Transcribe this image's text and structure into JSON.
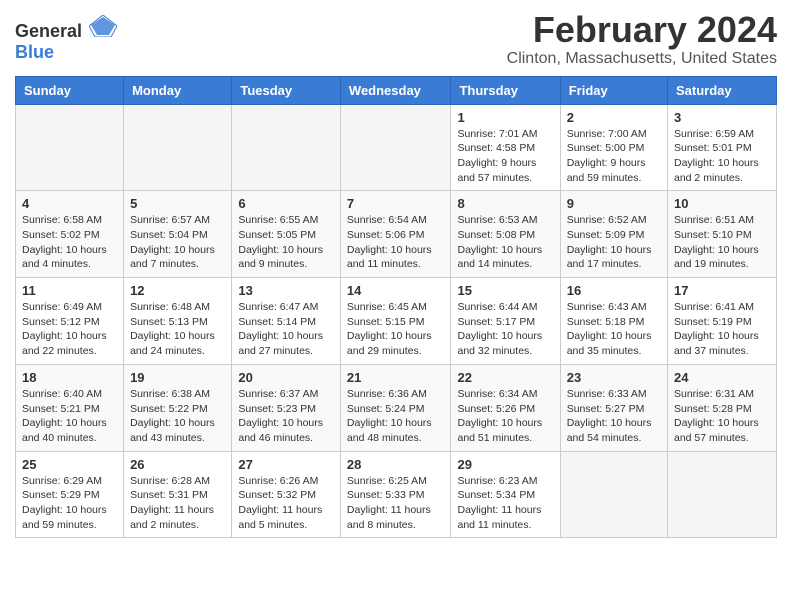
{
  "header": {
    "logo_general": "General",
    "logo_blue": "Blue",
    "title": "February 2024",
    "subtitle": "Clinton, Massachusetts, United States"
  },
  "columns": [
    "Sunday",
    "Monday",
    "Tuesday",
    "Wednesday",
    "Thursday",
    "Friday",
    "Saturday"
  ],
  "weeks": [
    [
      {
        "day": "",
        "info": ""
      },
      {
        "day": "",
        "info": ""
      },
      {
        "day": "",
        "info": ""
      },
      {
        "day": "",
        "info": ""
      },
      {
        "day": "1",
        "info": "Sunrise: 7:01 AM\nSunset: 4:58 PM\nDaylight: 9 hours and 57 minutes."
      },
      {
        "day": "2",
        "info": "Sunrise: 7:00 AM\nSunset: 5:00 PM\nDaylight: 9 hours and 59 minutes."
      },
      {
        "day": "3",
        "info": "Sunrise: 6:59 AM\nSunset: 5:01 PM\nDaylight: 10 hours and 2 minutes."
      }
    ],
    [
      {
        "day": "4",
        "info": "Sunrise: 6:58 AM\nSunset: 5:02 PM\nDaylight: 10 hours and 4 minutes."
      },
      {
        "day": "5",
        "info": "Sunrise: 6:57 AM\nSunset: 5:04 PM\nDaylight: 10 hours and 7 minutes."
      },
      {
        "day": "6",
        "info": "Sunrise: 6:55 AM\nSunset: 5:05 PM\nDaylight: 10 hours and 9 minutes."
      },
      {
        "day": "7",
        "info": "Sunrise: 6:54 AM\nSunset: 5:06 PM\nDaylight: 10 hours and 11 minutes."
      },
      {
        "day": "8",
        "info": "Sunrise: 6:53 AM\nSunset: 5:08 PM\nDaylight: 10 hours and 14 minutes."
      },
      {
        "day": "9",
        "info": "Sunrise: 6:52 AM\nSunset: 5:09 PM\nDaylight: 10 hours and 17 minutes."
      },
      {
        "day": "10",
        "info": "Sunrise: 6:51 AM\nSunset: 5:10 PM\nDaylight: 10 hours and 19 minutes."
      }
    ],
    [
      {
        "day": "11",
        "info": "Sunrise: 6:49 AM\nSunset: 5:12 PM\nDaylight: 10 hours and 22 minutes."
      },
      {
        "day": "12",
        "info": "Sunrise: 6:48 AM\nSunset: 5:13 PM\nDaylight: 10 hours and 24 minutes."
      },
      {
        "day": "13",
        "info": "Sunrise: 6:47 AM\nSunset: 5:14 PM\nDaylight: 10 hours and 27 minutes."
      },
      {
        "day": "14",
        "info": "Sunrise: 6:45 AM\nSunset: 5:15 PM\nDaylight: 10 hours and 29 minutes."
      },
      {
        "day": "15",
        "info": "Sunrise: 6:44 AM\nSunset: 5:17 PM\nDaylight: 10 hours and 32 minutes."
      },
      {
        "day": "16",
        "info": "Sunrise: 6:43 AM\nSunset: 5:18 PM\nDaylight: 10 hours and 35 minutes."
      },
      {
        "day": "17",
        "info": "Sunrise: 6:41 AM\nSunset: 5:19 PM\nDaylight: 10 hours and 37 minutes."
      }
    ],
    [
      {
        "day": "18",
        "info": "Sunrise: 6:40 AM\nSunset: 5:21 PM\nDaylight: 10 hours and 40 minutes."
      },
      {
        "day": "19",
        "info": "Sunrise: 6:38 AM\nSunset: 5:22 PM\nDaylight: 10 hours and 43 minutes."
      },
      {
        "day": "20",
        "info": "Sunrise: 6:37 AM\nSunset: 5:23 PM\nDaylight: 10 hours and 46 minutes."
      },
      {
        "day": "21",
        "info": "Sunrise: 6:36 AM\nSunset: 5:24 PM\nDaylight: 10 hours and 48 minutes."
      },
      {
        "day": "22",
        "info": "Sunrise: 6:34 AM\nSunset: 5:26 PM\nDaylight: 10 hours and 51 minutes."
      },
      {
        "day": "23",
        "info": "Sunrise: 6:33 AM\nSunset: 5:27 PM\nDaylight: 10 hours and 54 minutes."
      },
      {
        "day": "24",
        "info": "Sunrise: 6:31 AM\nSunset: 5:28 PM\nDaylight: 10 hours and 57 minutes."
      }
    ],
    [
      {
        "day": "25",
        "info": "Sunrise: 6:29 AM\nSunset: 5:29 PM\nDaylight: 10 hours and 59 minutes."
      },
      {
        "day": "26",
        "info": "Sunrise: 6:28 AM\nSunset: 5:31 PM\nDaylight: 11 hours and 2 minutes."
      },
      {
        "day": "27",
        "info": "Sunrise: 6:26 AM\nSunset: 5:32 PM\nDaylight: 11 hours and 5 minutes."
      },
      {
        "day": "28",
        "info": "Sunrise: 6:25 AM\nSunset: 5:33 PM\nDaylight: 11 hours and 8 minutes."
      },
      {
        "day": "29",
        "info": "Sunrise: 6:23 AM\nSunset: 5:34 PM\nDaylight: 11 hours and 11 minutes."
      },
      {
        "day": "",
        "info": ""
      },
      {
        "day": "",
        "info": ""
      }
    ]
  ]
}
